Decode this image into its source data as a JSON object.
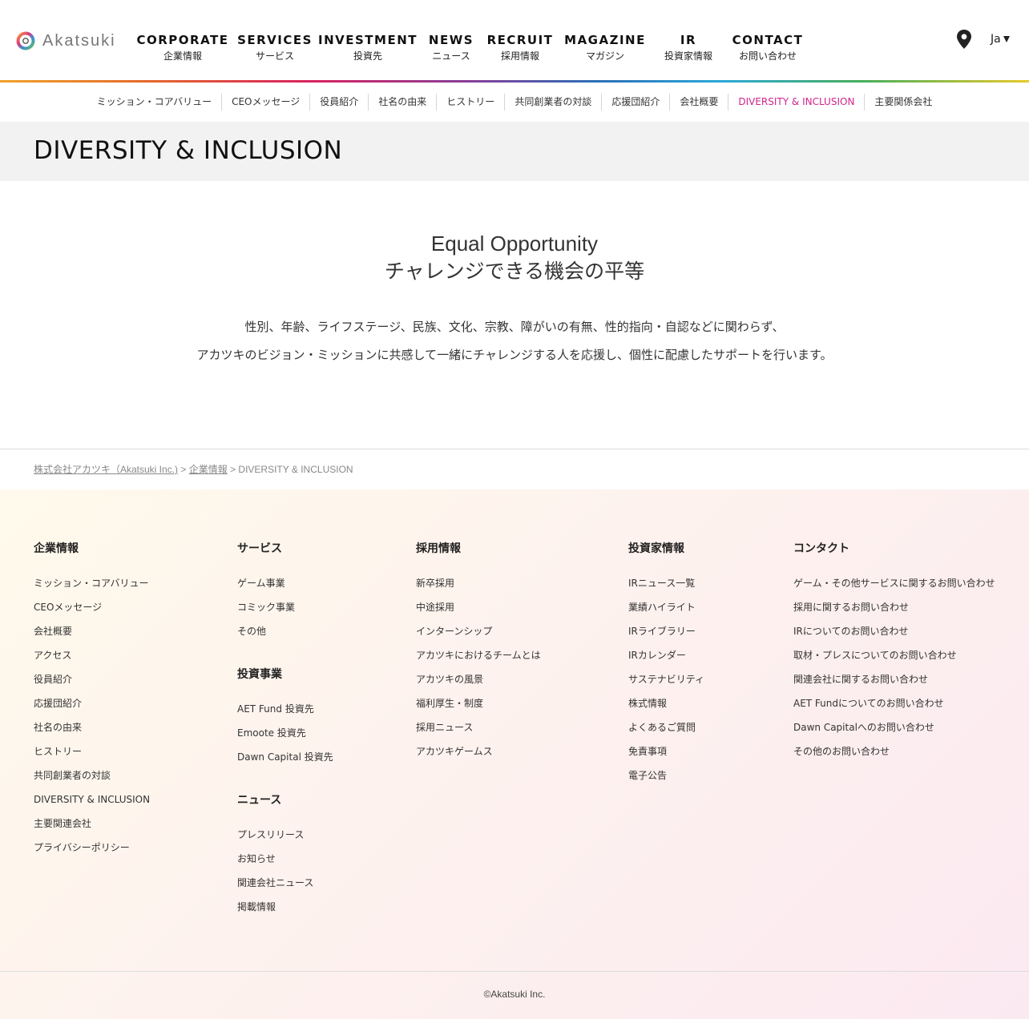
{
  "brand": {
    "name": "Akatsuki",
    "logo_icon": "akatsuki-ring-logo"
  },
  "nav": [
    {
      "en": "CORPORATE",
      "ja": "企業情報"
    },
    {
      "en": "SERVICES",
      "ja": "サービス"
    },
    {
      "en": "INVESTMENT",
      "ja": "投資先"
    },
    {
      "en": "NEWS",
      "ja": "ニュース"
    },
    {
      "en": "RECRUIT",
      "ja": "採用情報"
    },
    {
      "en": "MAGAZINE",
      "ja": "マガジン"
    },
    {
      "en": "IR",
      "ja": "投資家情報"
    },
    {
      "en": "CONTACT",
      "ja": "お問い合わせ"
    }
  ],
  "utility": {
    "location_icon": "map-pin-icon",
    "language": "Ja"
  },
  "subnav": [
    "ミッション・コアバリュー",
    "CEOメッセージ",
    "役員紹介",
    "社名の由来",
    "ヒストリー",
    "共同創業者の対談",
    "応援団紹介",
    "会社概要",
    "DIVERSITY & INCLUSION",
    "主要関係会社"
  ],
  "subnav_active": "DIVERSITY & INCLUSION",
  "page_title": "DIVERSITY & INCLUSION",
  "section": {
    "title_en": "Equal Opportunity",
    "title_ja": "チャレンジできる機会の平等",
    "paragraph_line1": "性別、年齢、ライフステージ、民族、文化、宗教、障がいの有無、性的指向・自認などに関わらず、",
    "paragraph_line2": "アカツキのビジョン・ミッションに共感して一緒にチャレンジする人を応援し、個性に配慮したサポートを行います。"
  },
  "breadcrumb": {
    "home": "株式会社アカツキ（Akatsuki Inc.)",
    "sep1": " > ",
    "parent": "企業情報",
    "sep2": " > ",
    "current": "DIVERSITY & INCLUSION"
  },
  "footer": {
    "corporate": {
      "heading": "企業情報",
      "links": [
        "ミッション・コアバリュー",
        "CEOメッセージ",
        "会社概要",
        "アクセス",
        "役員紹介",
        "応援団紹介",
        "社名の由来",
        "ヒストリー",
        "共同創業者の対談",
        "DIVERSITY & INCLUSION",
        "主要関連会社",
        "プライバシーポリシー"
      ]
    },
    "services": {
      "heading": "サービス",
      "links": [
        "ゲーム事業",
        "コミック事業",
        "その他"
      ]
    },
    "investment": {
      "heading": "投資事業",
      "links": [
        "AET Fund 投資先",
        "Emoote 投資先",
        "Dawn Capital 投資先"
      ]
    },
    "news": {
      "heading": "ニュース",
      "links": [
        "プレスリリース",
        "お知らせ",
        "関連会社ニュース",
        "掲載情報"
      ]
    },
    "recruit": {
      "heading": "採用情報",
      "links": [
        "新卒採用",
        "中途採用",
        "インターンシップ",
        "アカツキにおけるチームとは",
        "アカツキの風景",
        "福利厚生・制度",
        "採用ニュース",
        "アカツキゲームス"
      ]
    },
    "ir": {
      "heading": "投資家情報",
      "links": [
        "IRニュース一覧",
        "業績ハイライト",
        "IRライブラリー",
        "IRカレンダー",
        "サステナビリティ",
        "株式情報",
        "よくあるご質問",
        "免責事項",
        "電子公告"
      ]
    },
    "contact": {
      "heading": "コンタクト",
      "links": [
        "ゲーム・その他サービスに関するお問い合わせ",
        "採用に関するお問い合わせ",
        "IRについてのお問い合わせ",
        "取材・プレスについてのお問い合わせ",
        "関連会社に関するお問い合わせ",
        "AET Fundについてのお問い合わせ",
        "Dawn Capitalへのお問い合わせ",
        "その他のお問い合わせ"
      ]
    },
    "copyright": "©Akatsuki Inc."
  },
  "colors": {
    "accent": "#d1248b",
    "title_band": "#f2f2f2"
  }
}
